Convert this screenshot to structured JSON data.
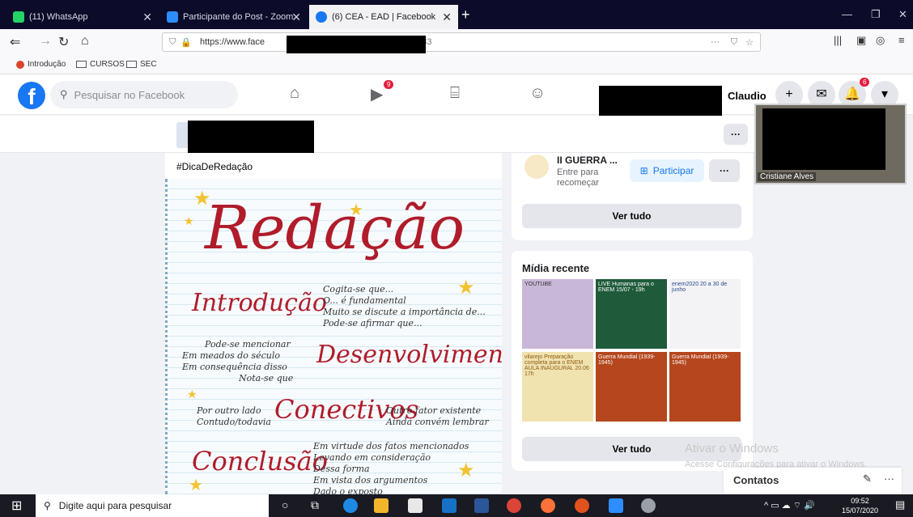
{
  "browser": {
    "tabs": [
      {
        "label": "(11) WhatsApp",
        "color": "#25d366"
      },
      {
        "label": "Participante do Post - Zoom",
        "color": "#2d8cff"
      },
      {
        "label": "(6) CEA - EAD | Facebook",
        "color": "#1877f2"
      }
    ],
    "url_prefix": "https://www.face",
    "url_suffix": "3333",
    "bookmarks": [
      "Introdução",
      "CURSOS",
      "SEC"
    ]
  },
  "facebook": {
    "logo": "f",
    "search_placeholder": "Pesquisar no Facebook",
    "watch_badge": "9",
    "notif_badge": "6",
    "username": "Claudio",
    "more_dots": "···"
  },
  "post": {
    "hashtag": "#DicaDeRedação",
    "image": {
      "title": "Redação",
      "sections": [
        {
          "heading": "Introdução",
          "lines": [
            "Cogita-se que...",
            "O... é fundamental",
            "Muito se discute a importância de...",
            "Pode-se afirmar que..."
          ]
        },
        {
          "heading": "Desenvolvimento",
          "lines": [
            "Pode-se mencionar",
            "Em meados do século",
            "Em consequência disso",
            "Nota-se que"
          ]
        },
        {
          "heading": "Conectivos",
          "lines": [
            "Por outro lado",
            "Contudo/todavia",
            "Outro fator existente",
            "Ainda convém lembrar"
          ]
        },
        {
          "heading": "Conclusão",
          "lines": [
            "Em virtude dos fatos mencionados",
            "Levando em consideração",
            "Dessa forma",
            "Em vista dos argumentos",
            "Dado o exposto"
          ]
        }
      ]
    }
  },
  "groups_card": {
    "group_name": "II GUERRA ...",
    "group_sub": "Entre para recomeçar",
    "join_button": "Participar",
    "more": "···",
    "see_all": "Ver tudo"
  },
  "media_card": {
    "title": "Mídia recente",
    "see_all": "Ver tudo",
    "thumbs": [
      {
        "text": "YOUTUBE",
        "bg": "#c9b7d8"
      },
      {
        "text": "LIVE Humanas para o ENEM 15/07 - 19h",
        "bg": "#1f5b3a"
      },
      {
        "text": "enem2020 20 a 30 de junho",
        "bg": "#f3f3f6"
      },
      {
        "text": "vilarejo Preparação completa para o ENEM AULA INAUGURAL 20.06 17h",
        "bg": "#f1e3b0"
      },
      {
        "text": "Guerra Mundial (1939-1945)",
        "bg": "#b5461d"
      },
      {
        "text": "Guerra Mundial (1939-1945)",
        "bg": "#b5461d"
      }
    ]
  },
  "video_call": {
    "participant": "Cristiane Alves"
  },
  "windows": {
    "activate_title": "Ativar o Windows",
    "activate_sub": "Acesse Configurações para ativar o Windows.",
    "contacts": "Contatos",
    "search_placeholder": "Digite aqui para pesquisar",
    "time": "09:52",
    "date": "15/07/2020"
  }
}
